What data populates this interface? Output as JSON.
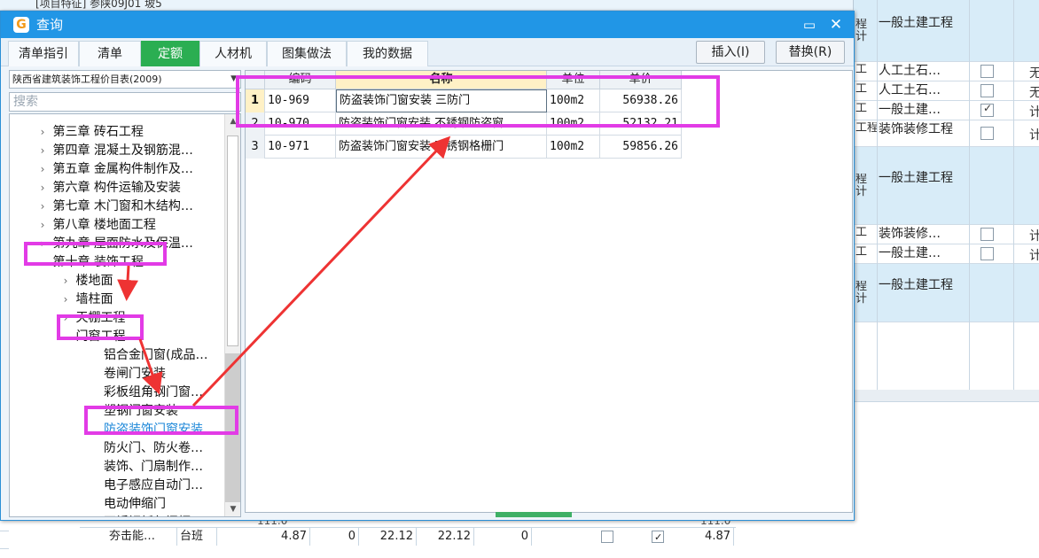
{
  "background": {
    "top_strip_text": "[项目特征]  参陕09J01 坡5",
    "right_rows": [
      {
        "c1": "程\n计",
        "c2": "一般土建工程",
        "checkbox": false,
        "c4": "",
        "blue": true
      },
      {
        "c1": "工",
        "c2": "人工土石…",
        "checkbox": true,
        "checked": false,
        "c4": "无",
        "blue": false
      },
      {
        "c1": "工",
        "c2": "人工土石…",
        "checkbox": true,
        "checked": false,
        "c4": "无",
        "blue": false
      },
      {
        "c1": "工",
        "c2": "一般土建…",
        "checkbox": true,
        "checked": true,
        "c4": "计",
        "blue": false
      },
      {
        "c1": "工程",
        "c2": "装饰装修工程",
        "checkbox": true,
        "checked": false,
        "c4": "计",
        "blue": false
      },
      {
        "c1": "程\n计",
        "c2": "一般土建工程",
        "checkbox": false,
        "c4": "",
        "blue": true
      },
      {
        "c1": "工",
        "c2": "装饰装修…",
        "checkbox": true,
        "checked": false,
        "c4": "计",
        "blue": false
      },
      {
        "c1": "工",
        "c2": "一般土建…",
        "checkbox": true,
        "checked": false,
        "c4": "计",
        "blue": false
      },
      {
        "c1": "程\n计",
        "c2": "一般土建工程",
        "checkbox": false,
        "c4": "",
        "blue": true
      }
    ],
    "partial_row_text": "111.0",
    "bottom_row": {
      "name": "夯击能…",
      "unit": "台班",
      "qty": "4.87",
      "v1": "0",
      "v2": "22.12",
      "v3": "22.12",
      "v4": "0",
      "total": "4.87"
    }
  },
  "dialog": {
    "icon_glyph": "G",
    "title": "查询",
    "maximize_glyph": "▭",
    "close_glyph": "✕",
    "tabs": [
      "清单指引",
      "清单",
      "定额",
      "人材机",
      "图集做法",
      "我的数据"
    ],
    "active_tab": "定额",
    "insert_label": "插入(I)",
    "replace_label": "替换(R)",
    "library_select": "陕西省建筑装饰工程价目表(2009)",
    "search_placeholder": "搜索",
    "tree": [
      {
        "label": "第三章  砖石工程",
        "level": 1,
        "state": "collapsed"
      },
      {
        "label": "第四章  混凝土及钢筋混…",
        "level": 1,
        "state": "collapsed"
      },
      {
        "label": "第五章  金属构件制作及…",
        "level": 1,
        "state": "collapsed"
      },
      {
        "label": "第六章  构件运输及安装",
        "level": 1,
        "state": "collapsed"
      },
      {
        "label": "第七章  木门窗和木结构…",
        "level": 1,
        "state": "collapsed"
      },
      {
        "label": "第八章  楼地面工程",
        "level": 1,
        "state": "collapsed"
      },
      {
        "label": "第九章  屋面防水及保温…",
        "level": 1,
        "state": "collapsed"
      },
      {
        "label": "第十章  装饰工程",
        "level": 1,
        "state": "expanded"
      },
      {
        "label": "楼地面",
        "level": 2,
        "state": "collapsed"
      },
      {
        "label": "墙柱面",
        "level": 2,
        "state": "collapsed"
      },
      {
        "label": "天棚工程",
        "level": 2,
        "state": "collapsed"
      },
      {
        "label": "门窗工程",
        "level": 2,
        "state": "expanded"
      },
      {
        "label": "铝合金门窗(成品…",
        "level": 3,
        "state": "leaf"
      },
      {
        "label": "卷闸门安装",
        "level": 3,
        "state": "leaf"
      },
      {
        "label": "彩板组角钢门窗…",
        "level": 3,
        "state": "leaf"
      },
      {
        "label": "塑钢门窗安装",
        "level": 3,
        "state": "leaf"
      },
      {
        "label": "防盗装饰门窗安装",
        "level": 3,
        "state": "selected"
      },
      {
        "label": "防火门、防火卷…",
        "level": 3,
        "state": "leaf"
      },
      {
        "label": "装饰、门扇制作…",
        "level": 3,
        "state": "leaf"
      },
      {
        "label": "电子感应自动门…",
        "level": 3,
        "state": "leaf"
      },
      {
        "label": "电动伸缩门",
        "level": 3,
        "state": "leaf"
      },
      {
        "label": "不锈钢板包门框…",
        "level": 3,
        "state": "leaf"
      }
    ],
    "table": {
      "columns": [
        "",
        "编码",
        "名称",
        "单位",
        "单价"
      ],
      "rows": [
        {
          "index": "1",
          "code": "10-969",
          "name": "防盗装饰门窗安装 三防门",
          "unit": "100m2",
          "price": "56938.26"
        },
        {
          "index": "2",
          "code": "10-970",
          "name": "防盗装饰门窗安装 不锈钢防盗窗",
          "unit": "100m2",
          "price": "52132.21"
        },
        {
          "index": "3",
          "code": "10-971",
          "name": "防盗装饰门窗安装 不锈钢格栅门",
          "unit": "100m2",
          "price": "59856.26"
        }
      ],
      "selected_row": 1
    }
  },
  "annotation_color": "#e23be6",
  "arrow_color": "#ee3333"
}
